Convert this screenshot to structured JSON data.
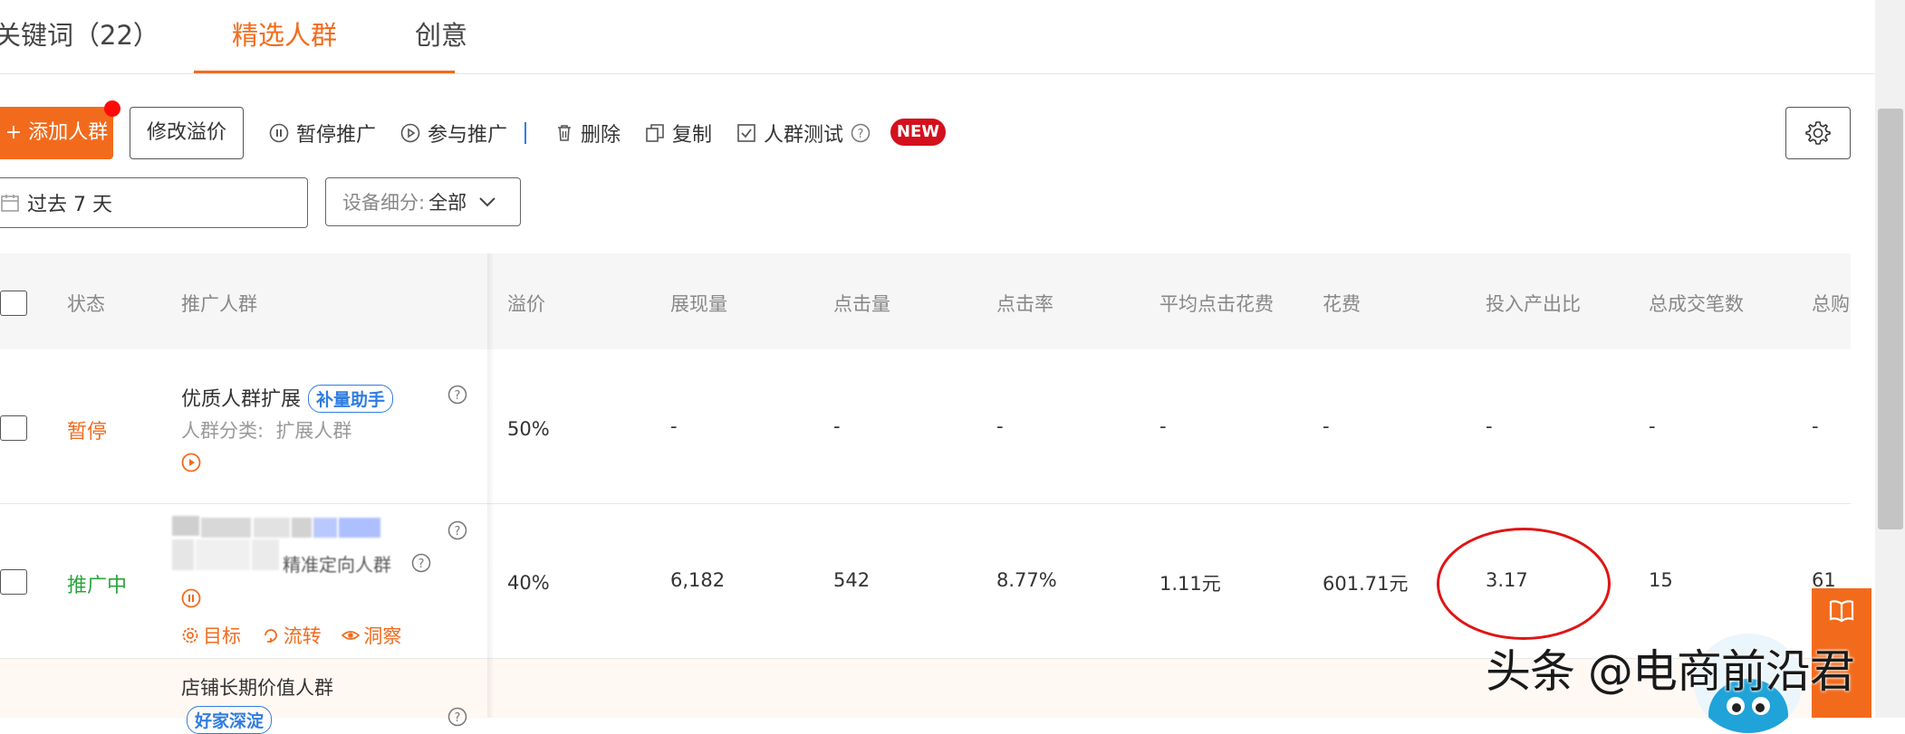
{
  "tabs": [
    {
      "label": "关键词（22）"
    },
    {
      "label": "精选人群"
    },
    {
      "label": "创意"
    }
  ],
  "toolbar": {
    "add_label": "+ 添加人群",
    "modify_label": "修改溢价",
    "pause_label": "暂停推广",
    "join_label": "参与推广",
    "delete_label": "删除",
    "copy_label": "复制",
    "test_label": "人群测试",
    "new_badge": "NEW"
  },
  "filters": {
    "date_value": "过去 7 天",
    "device_label": "设备细分:",
    "device_value": "全部"
  },
  "table": {
    "headers": [
      "状态",
      "推广人群",
      "溢价",
      "展现量",
      "点击量",
      "点击率",
      "平均点击花费",
      "花费",
      "投入产出比",
      "总成交笔数",
      "总购"
    ],
    "rows": [
      {
        "status": "暂停",
        "name": "优质人群扩展",
        "tag": "补量助手",
        "category_label": "人群分类:",
        "category_value": "扩展人群",
        "premium": "50%",
        "impressions": "-",
        "clicks": "-",
        "ctr": "-",
        "avg_cpc": "-",
        "cost": "-",
        "roi": "-",
        "orders": "-",
        "fav": "-"
      },
      {
        "status": "推广中",
        "name_suffix": "精准定向人群",
        "premium": "40%",
        "impressions": "6,182",
        "clicks": "542",
        "ctr": "8.77%",
        "avg_cpc": "1.11元",
        "cost": "601.71元",
        "roi": "3.17",
        "orders": "15",
        "fav": "61",
        "actions": [
          "目标",
          "流转",
          "洞察"
        ]
      },
      {
        "name": "店铺长期价值人群",
        "tag": "好家深淀"
      }
    ]
  },
  "watermark": "头条 @电商前沿君",
  "colors": {
    "accent": "#f26b1d",
    "active": "#2aa53b",
    "link_blue": "#2f7de1",
    "badge_red": "#d4101c",
    "annotation_red": "#e01515"
  }
}
